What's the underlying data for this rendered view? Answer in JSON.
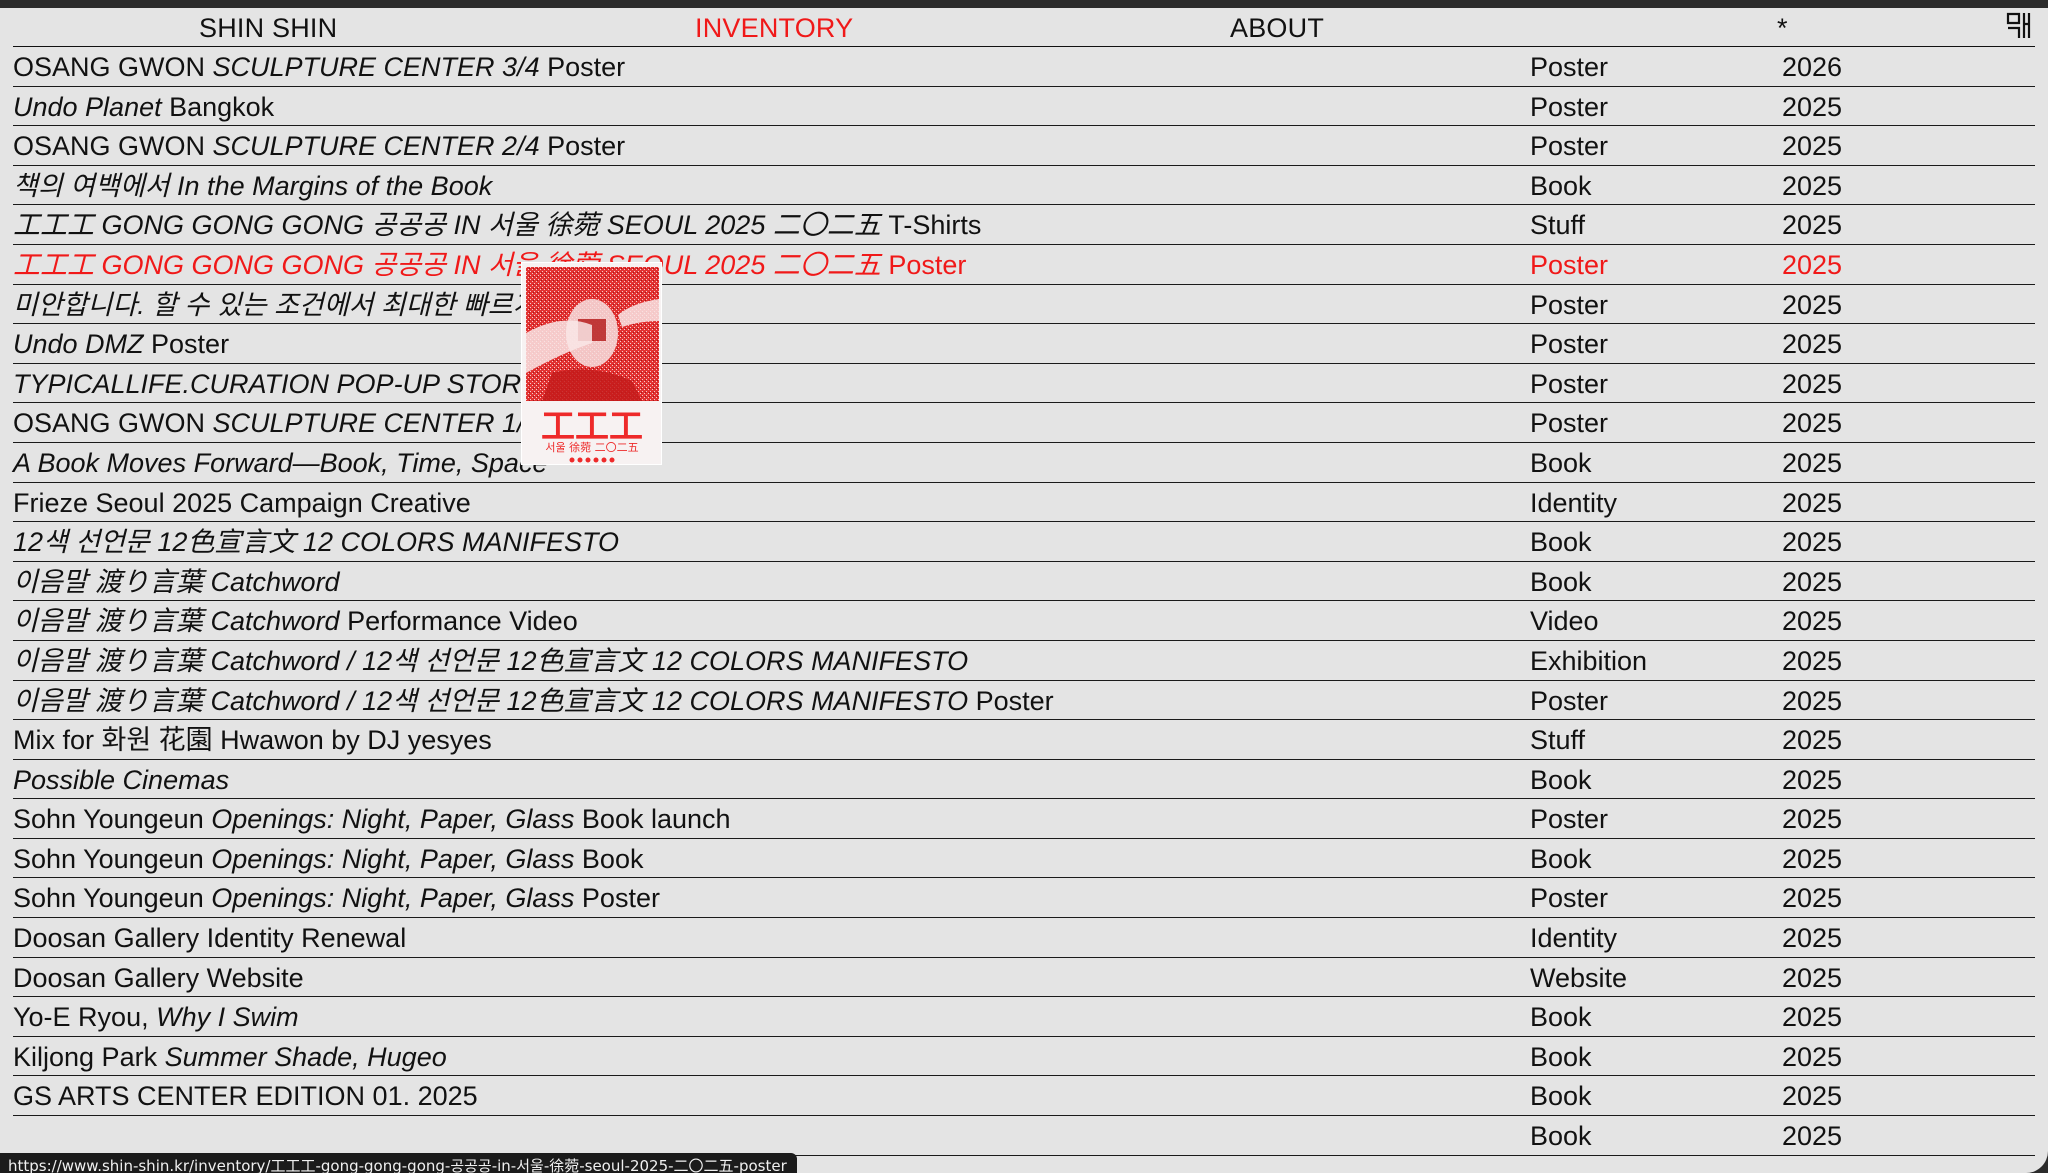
{
  "nav": {
    "home": "SHIN SHIN",
    "inventory": "INVENTORY",
    "about": "ABOUT",
    "star": "*",
    "language_icon": "korean-language-toggle-icon",
    "active_color": "#f01919"
  },
  "rows": [
    {
      "title": [
        {
          "t": "OSANG GWON "
        },
        {
          "t": "SCULPTURE CENTER 3/4",
          "i": true
        },
        {
          "t": " Poster"
        }
      ],
      "category": "Poster",
      "year": "2026"
    },
    {
      "title": [
        {
          "t": "Undo Planet",
          "i": true
        },
        {
          "t": " Bangkok"
        }
      ],
      "category": "Poster",
      "year": "2025"
    },
    {
      "title": [
        {
          "t": "OSANG GWON "
        },
        {
          "t": "SCULPTURE CENTER 2/4",
          "i": true
        },
        {
          "t": " Poster"
        }
      ],
      "category": "Poster",
      "year": "2025"
    },
    {
      "title": [
        {
          "t": "책의 여백에서 In the Margins of the Book",
          "i": true
        }
      ],
      "category": "Book",
      "year": "2025"
    },
    {
      "title": [
        {
          "t": "工工工 GONG GONG GONG 공공공 IN 서울 徐菀 SEOUL 2025 二〇二五",
          "i": true
        },
        {
          "t": " T-Shirts"
        }
      ],
      "category": "Stuff",
      "year": "2025"
    },
    {
      "title": [
        {
          "t": "工工工 GONG GONG GONG 공공공 IN 서울 徐菀 SEOUL 2025 二〇二五",
          "i": true
        },
        {
          "t": " Poster"
        }
      ],
      "category": "Poster",
      "year": "2025",
      "hover": true
    },
    {
      "title": [
        {
          "t": "미안합니다. 할 수 있는 조건에서 최대한 빠르게",
          "i": true
        }
      ],
      "category": "Poster",
      "year": "2025"
    },
    {
      "title": [
        {
          "t": "Undo DMZ",
          "i": true
        },
        {
          "t": " Poster"
        }
      ],
      "category": "Poster",
      "year": "2025"
    },
    {
      "title": [
        {
          "t": "TYPICALLIFE.CURATION POP-UP STORE",
          "i": true
        }
      ],
      "category": "Poster",
      "year": "2025"
    },
    {
      "title": [
        {
          "t": "OSANG GWON "
        },
        {
          "t": "SCULPTURE CENTER 1/4",
          "i": true
        },
        {
          "t": " Poster"
        }
      ],
      "category": "Poster",
      "year": "2025"
    },
    {
      "title": [
        {
          "t": "A Book Moves Forward—Book, Time, Space",
          "i": true
        }
      ],
      "category": "Book",
      "year": "2025"
    },
    {
      "title": [
        {
          "t": "Frieze Seoul 2025 Campaign Creative"
        }
      ],
      "category": "Identity",
      "year": "2025"
    },
    {
      "title": [
        {
          "t": "12색 선언문 12色宣言文 12 COLORS MANIFESTO",
          "i": true
        }
      ],
      "category": "Book",
      "year": "2025"
    },
    {
      "title": [
        {
          "t": "이음말 渡り言葉 Catchword",
          "i": true
        }
      ],
      "category": "Book",
      "year": "2025"
    },
    {
      "title": [
        {
          "t": "이음말 渡り言葉 Catchword",
          "i": true
        },
        {
          "t": " Performance Video"
        }
      ],
      "category": "Video",
      "year": "2025"
    },
    {
      "title": [
        {
          "t": "이음말 渡り言葉 Catchword / 12색 선언문 12色宣言文 12 COLORS MANIFESTO",
          "i": true
        }
      ],
      "category": "Exhibition",
      "year": "2025"
    },
    {
      "title": [
        {
          "t": "이음말 渡り言葉 Catchword / 12색 선언문 12色宣言文 12 COLORS MANIFESTO",
          "i": true
        },
        {
          "t": " Poster"
        }
      ],
      "category": "Poster",
      "year": "2025"
    },
    {
      "title": [
        {
          "t": "Mix for 화원 花園 Hwawon by DJ yesyes"
        }
      ],
      "category": "Stuff",
      "year": "2025"
    },
    {
      "title": [
        {
          "t": "Possible Cinemas",
          "i": true
        }
      ],
      "category": "Book",
      "year": "2025"
    },
    {
      "title": [
        {
          "t": "Sohn Youngeun "
        },
        {
          "t": "Openings: Night, Paper, Glass",
          "i": true
        },
        {
          "t": " Book launch"
        }
      ],
      "category": "Poster",
      "year": "2025"
    },
    {
      "title": [
        {
          "t": "Sohn Youngeun "
        },
        {
          "t": "Openings: Night, Paper, Glass",
          "i": true
        },
        {
          "t": " Book"
        }
      ],
      "category": "Book",
      "year": "2025"
    },
    {
      "title": [
        {
          "t": "Sohn Youngeun "
        },
        {
          "t": "Openings: Night, Paper, Glass",
          "i": true
        },
        {
          "t": " Poster"
        }
      ],
      "category": "Poster",
      "year": "2025"
    },
    {
      "title": [
        {
          "t": "Doosan Gallery Identity Renewal"
        }
      ],
      "category": "Identity",
      "year": "2025"
    },
    {
      "title": [
        {
          "t": "Doosan Gallery Website"
        }
      ],
      "category": "Website",
      "year": "2025"
    },
    {
      "title": [
        {
          "t": "Yo-E Ryou, "
        },
        {
          "t": "Why I Swim",
          "i": true
        }
      ],
      "category": "Book",
      "year": "2025"
    },
    {
      "title": [
        {
          "t": "Kiljong Park "
        },
        {
          "t": "Summer Shade, Hugeo",
          "i": true
        }
      ],
      "category": "Book",
      "year": "2025"
    },
    {
      "title": [
        {
          "t": "GS ARTS CENTER EDITION 01. 2025"
        }
      ],
      "category": "Book",
      "year": "2025"
    },
    {
      "title": [
        {
          "t": ""
        }
      ],
      "category": "Book",
      "year": "2025"
    }
  ],
  "preview": {
    "big_text": "工工工",
    "small_text": "서울 徐菀 二〇二五",
    "accent": "#ee2a2a"
  },
  "status_url": "https://www.shin-shin.kr/inventory/工工工-gong-gong-gong-공공공-in-서울-徐菀-seoul-2025-二〇二五-poster"
}
